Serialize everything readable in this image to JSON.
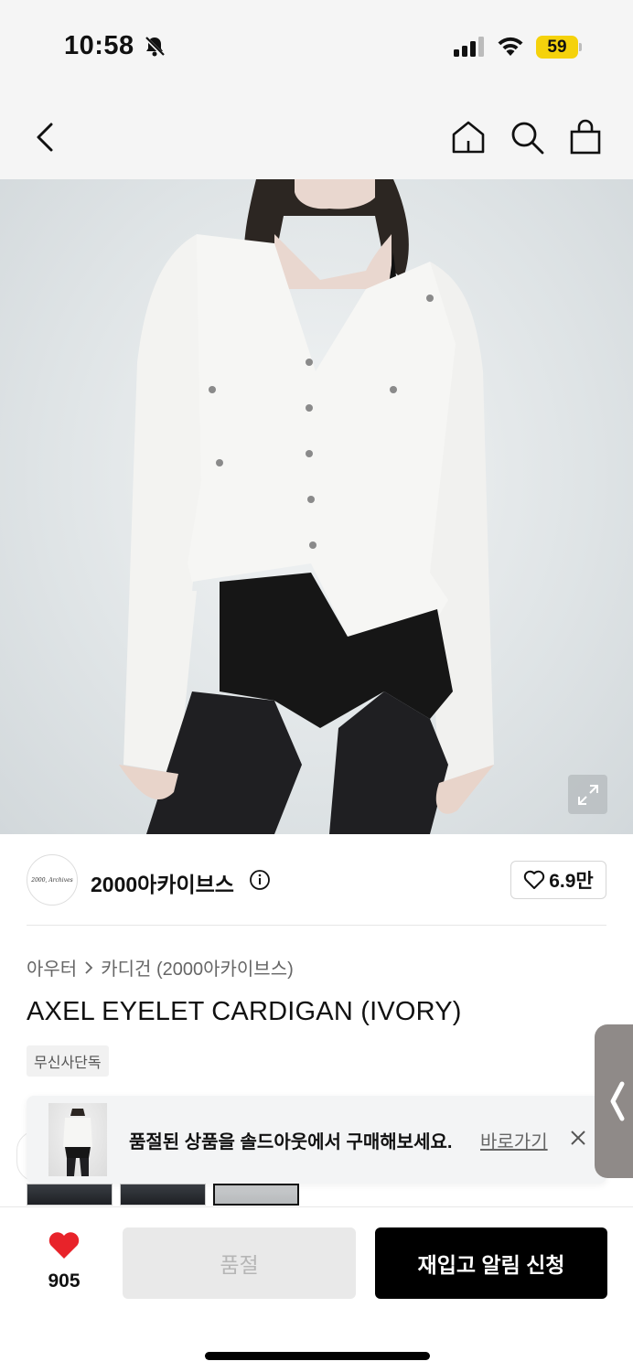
{
  "status": {
    "time": "10:58",
    "battery": "59",
    "colors": {
      "battery": "#f5d20c"
    }
  },
  "nav": {
    "icons": [
      "back-icon",
      "home-icon",
      "search-icon",
      "shopping-bag-icon"
    ]
  },
  "brand": {
    "name": "2000아카이브스",
    "logo_text": "2000, Archives",
    "likes": "6.9만"
  },
  "product": {
    "breadcrumb": [
      "아우터",
      "카디건 (2000아카이브스)"
    ],
    "title": "AXEL EYELET CARDIGAN (IVORY)",
    "tag": "무신사단독"
  },
  "toast": {
    "message": "품절된 상품을 솔드아웃에서 구매해보세요.",
    "link": "바로가기"
  },
  "bottom": {
    "wish_count": "905",
    "soldout_label": "품절",
    "restock_label": "재입고 알림 신청"
  },
  "colors": {
    "accent": "#000000",
    "heart": "#e8232a",
    "toast_bg": "#f3f4f5"
  }
}
